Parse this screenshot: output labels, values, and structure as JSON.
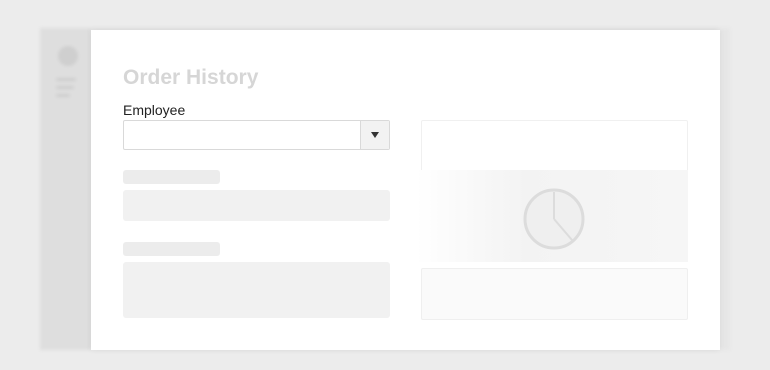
{
  "modal": {
    "title": "Order History",
    "employee_label": "Employee",
    "employee_value": ""
  },
  "state": {
    "loading": true
  },
  "icons": {
    "dropdown": "caret-down-icon",
    "chart": "pie-chart-icon"
  },
  "colors": {
    "page_background": "#ececec",
    "panel": "#ffffff",
    "skeleton": "#f1f1f1",
    "title": "#d6d6d6"
  }
}
